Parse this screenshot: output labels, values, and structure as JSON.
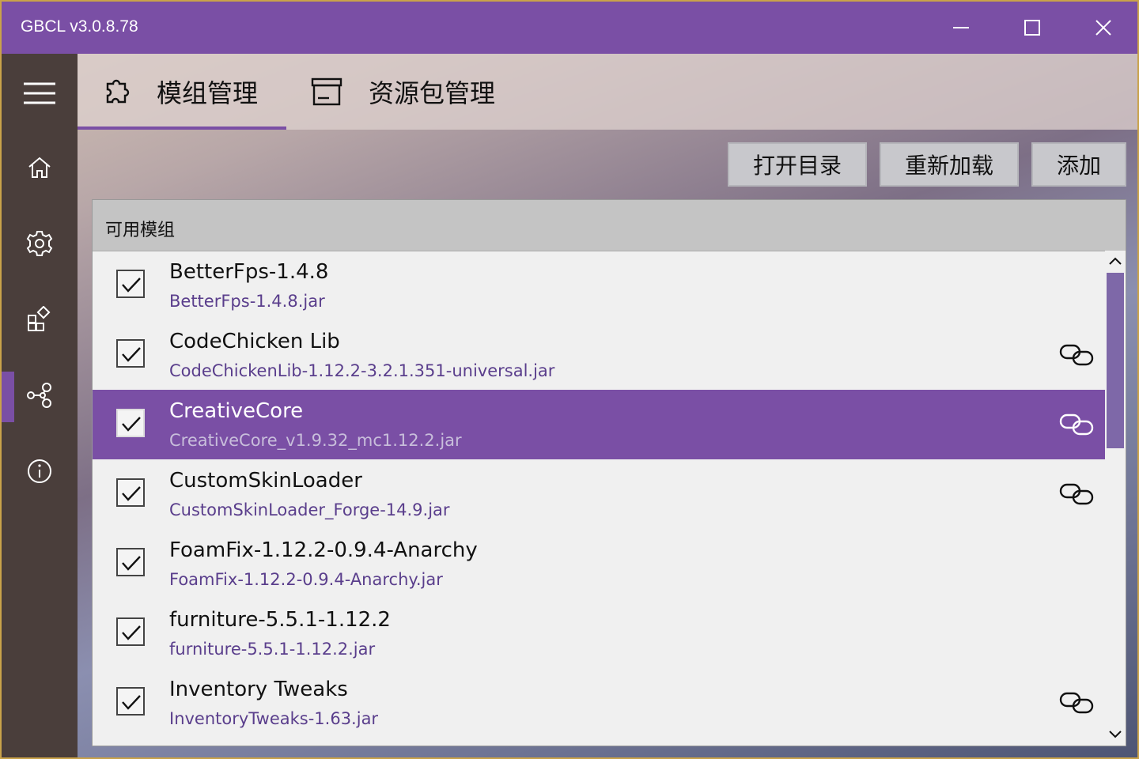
{
  "window": {
    "title": "GBCL v3.0.8.78"
  },
  "tabs": [
    {
      "label": "模组管理",
      "icon": "puzzle-icon",
      "active": true
    },
    {
      "label": "资源包管理",
      "icon": "archive-box-icon",
      "active": false
    }
  ],
  "actions": {
    "open_dir": "打开目录",
    "reload": "重新加载",
    "add": "添加"
  },
  "panel": {
    "header": "可用模组"
  },
  "sidebar": {
    "items": [
      "menu-icon",
      "home-icon",
      "gear-icon",
      "apps-icon",
      "mods-icon",
      "info-icon"
    ],
    "selected": "mods-icon"
  },
  "mods": [
    {
      "name": "BetterFps-1.4.8",
      "file": "BetterFps-1.4.8.jar",
      "checked": true,
      "link": false
    },
    {
      "name": "CodeChicken Lib",
      "file": "CodeChickenLib-1.12.2-3.2.1.351-universal.jar",
      "checked": true,
      "link": true
    },
    {
      "name": "CreativeCore",
      "file": "CreativeCore_v1.9.32_mc1.12.2.jar",
      "checked": true,
      "link": true,
      "selected": true
    },
    {
      "name": "CustomSkinLoader",
      "file": "CustomSkinLoader_Forge-14.9.jar",
      "checked": true,
      "link": true
    },
    {
      "name": "FoamFix-1.12.2-0.9.4-Anarchy",
      "file": "FoamFix-1.12.2-0.9.4-Anarchy.jar",
      "checked": true,
      "link": false
    },
    {
      "name": "furniture-5.5.1-1.12.2",
      "file": "furniture-5.5.1-1.12.2.jar",
      "checked": true,
      "link": false
    },
    {
      "name": "Inventory Tweaks",
      "file": "InventoryTweaks-1.63.jar",
      "checked": true,
      "link": true
    }
  ],
  "colors": {
    "accent": "#7a4fa5",
    "sidebar": "#4a3e3b",
    "file_text": "#5a3e8c"
  }
}
